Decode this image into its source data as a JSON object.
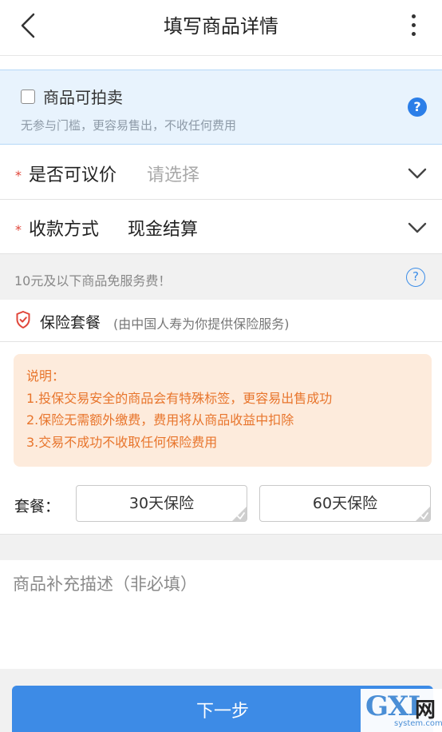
{
  "header": {
    "title": "填写商品详情"
  },
  "auction": {
    "label": "商品可拍卖",
    "subtitle": "无参与门槛，更容易售出，不收任何费用",
    "checked": false,
    "help_glyph": "?"
  },
  "negotiable": {
    "required_mark": "*",
    "label": "是否可议价",
    "value": "请选择"
  },
  "payment": {
    "required_mark": "*",
    "label": "收款方式",
    "value": "现金结算"
  },
  "fee_notice": {
    "text": "10元及以下商品免服务费！",
    "help_glyph": "?"
  },
  "insurance": {
    "title": "保险套餐",
    "provider_note": "(由中国人寿为你提供保险服务)"
  },
  "notes": {
    "heading": "说明：",
    "lines": [
      "1.投保交易安全的商品会有特殊标签，更容易出售成功",
      "2.保险无需额外缴费，费用将从商品收益中扣除",
      "3.交易不成功不收取任何保险费用"
    ]
  },
  "package": {
    "label": "套餐：",
    "options": [
      "30天保险",
      "60天保险"
    ]
  },
  "description": {
    "placeholder": "商品补充描述（非必填）",
    "value": ""
  },
  "footer": {
    "next_label": "下一步"
  },
  "watermark": {
    "mark": "GXI",
    "wang": "网",
    "site": "system.com"
  },
  "colors": {
    "accent": "#3d8be6",
    "required": "#e0463a",
    "note_text": "#e8752c",
    "note_bg": "#fdebdc",
    "auction_bg": "#e8f3fd"
  },
  "icons": {
    "back": "chevron-left-icon",
    "more": "more-vertical-icon",
    "dropdown": "chevron-down-icon",
    "shield": "shield-icon"
  }
}
